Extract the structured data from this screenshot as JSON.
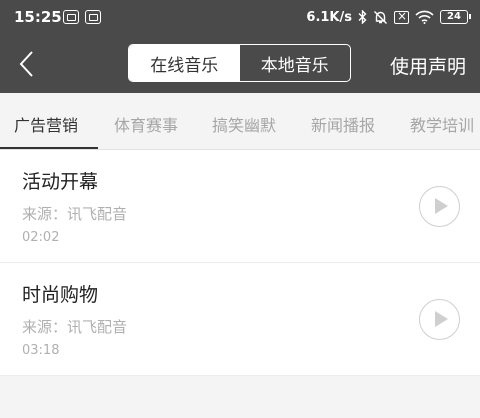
{
  "status_bar": {
    "time": "15:25",
    "net_speed": "6.1K/s",
    "battery": "24"
  },
  "nav": {
    "segments": [
      "在线音乐",
      "本地音乐"
    ],
    "active_segment": "在线音乐",
    "disclaimer": "使用声明"
  },
  "tabs": {
    "items": [
      "广告营销",
      "体育赛事",
      "搞笑幽默",
      "新闻播报",
      "教学培训"
    ],
    "active": "广告营销"
  },
  "list": {
    "items": [
      {
        "title": "活动开幕",
        "source": "来源：讯飞配音",
        "duration": "02:02"
      },
      {
        "title": "时尚购物",
        "source": "来源：讯飞配音",
        "duration": "03:18"
      }
    ]
  },
  "colors": {
    "header_bg": "#4a4a4a",
    "page_bg": "#f4f4f4",
    "muted_text": "#b0b0b0"
  }
}
